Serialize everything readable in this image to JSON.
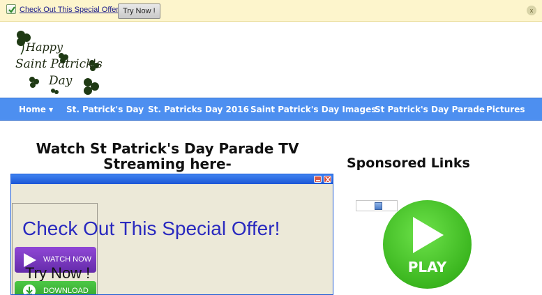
{
  "notice": {
    "link": "Check Out This Special Offer!",
    "button": "Try Now !",
    "close": "x"
  },
  "logo": {
    "line1": "Happy",
    "line2": "Saint Patrick's",
    "line3": "Day",
    "icon": "shamrock-icon"
  },
  "nav": {
    "items": [
      {
        "label": "Home"
      },
      {
        "label": "St. Patrick's Day"
      },
      {
        "label": "St. Patricks Day 2016"
      },
      {
        "label": "Saint Patrick's Day Images"
      },
      {
        "label": "St Patrick's Day Parade"
      },
      {
        "label": "Pictures"
      }
    ]
  },
  "main": {
    "title": "Watch St Patrick's Day Parade TV Streaming here-"
  },
  "popup": {
    "headline": "Check Out This Special Offer!",
    "try_label": "Try Now !",
    "watch_label": "WATCH NOW",
    "download_label": "DOWNLOAD"
  },
  "sidebar": {
    "heading": "Sponsored Links",
    "play_label": "PLAY"
  },
  "colors": {
    "nav_bg": "#4d8ff0",
    "notice_bg": "#fdf5cc",
    "play_green": "#3bb61f",
    "popup_headline": "#2a2abf"
  }
}
